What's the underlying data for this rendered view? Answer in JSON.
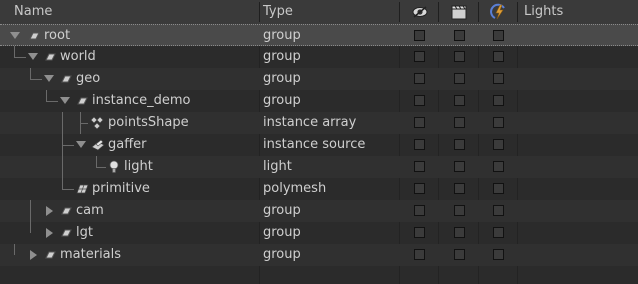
{
  "columns": {
    "name": "Name",
    "type": "Type",
    "visibility_icon": "eye-icon",
    "render_icon": "clapperboard-icon",
    "lights_icon": "lightning-icon",
    "lights": "Lights"
  },
  "rows": [
    {
      "name": "root",
      "type": "group",
      "icon": "group-icon",
      "expanded": true,
      "selected": true
    },
    {
      "name": "world",
      "type": "group",
      "icon": "group-icon",
      "expanded": true
    },
    {
      "name": "geo",
      "type": "group",
      "icon": "group-icon",
      "expanded": true
    },
    {
      "name": "instance_demo",
      "type": "group",
      "icon": "group-icon",
      "expanded": true
    },
    {
      "name": "pointsShape",
      "type": "instance array",
      "icon": "instance-array-icon"
    },
    {
      "name": "gaffer",
      "type": "instance source",
      "icon": "instance-source-icon",
      "expanded": true
    },
    {
      "name": "light",
      "type": "light",
      "icon": "light-bulb-icon"
    },
    {
      "name": "primitive",
      "type": "polymesh",
      "icon": "polymesh-icon"
    },
    {
      "name": "cam",
      "type": "group",
      "icon": "group-icon",
      "expanded": false
    },
    {
      "name": "lgt",
      "type": "group",
      "icon": "group-icon",
      "expanded": false
    },
    {
      "name": "materials",
      "type": "group",
      "icon": "group-icon",
      "expanded": false
    }
  ],
  "colors": {
    "background": "#2b2b2b",
    "header": "#3a3a3a",
    "selected_row": "#4a4a4a",
    "checkbox": "#3b3b3b",
    "lights_icon_blue": "#5a7fd6",
    "lights_icon_orange": "#e0a03a"
  }
}
